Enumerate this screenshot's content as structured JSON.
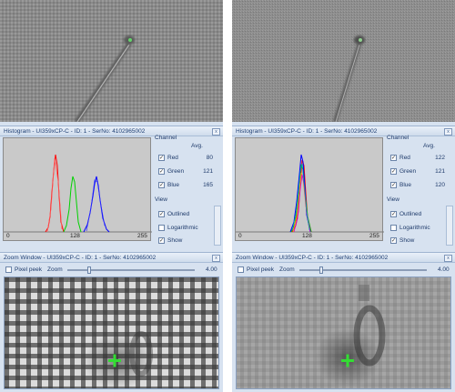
{
  "panels": [
    {
      "histogram": {
        "title": "Histogram - UI359xCP-C - ID: 1 - SerNo: 4102965002",
        "axis": {
          "ticks": [
            "0",
            "128",
            "255"
          ]
        },
        "channel_header": "Channel",
        "avg_header": "Avg.",
        "channels": [
          {
            "label": "Red",
            "avg": "80",
            "color": "#ff0000"
          },
          {
            "label": "Green",
            "avg": "121",
            "color": "#00cc00"
          },
          {
            "label": "Blue",
            "avg": "165",
            "color": "#0000ff"
          }
        ],
        "view_header": "View",
        "view_options": [
          {
            "label": "Outlined",
            "checked": true
          },
          {
            "label": "Logarithmic",
            "checked": false
          },
          {
            "label": "Show",
            "checked": true
          }
        ]
      },
      "zoom": {
        "title": "Zoom Window - UI359xCP-C - ID: 1 - SerNo: 4102965002",
        "pixel_peek_label": "Pixel peek",
        "zoom_label": "Zoom",
        "zoom_value": "4.00"
      }
    },
    {
      "histogram": {
        "title": "Histogram - UI359xCP-C - ID: 1 - SerNo: 4102965002",
        "axis": {
          "ticks": [
            "0",
            "128",
            "255"
          ]
        },
        "channel_header": "Channel",
        "avg_header": "Avg.",
        "channels": [
          {
            "label": "Red",
            "avg": "122",
            "color": "#ff0000"
          },
          {
            "label": "Green",
            "avg": "121",
            "color": "#00cc00"
          },
          {
            "label": "Blue",
            "avg": "120",
            "color": "#0000ff"
          }
        ],
        "view_header": "View",
        "view_options": [
          {
            "label": "Outlined",
            "checked": true
          },
          {
            "label": "Logarithmic",
            "checked": false
          },
          {
            "label": "Show",
            "checked": true
          }
        ]
      },
      "zoom": {
        "title": "Zoom Window - UI359xCP-C - ID: 1 - SerNo: 4102965002",
        "pixel_peek_label": "Pixel peek",
        "zoom_label": "Zoom",
        "zoom_value": "4.00"
      }
    }
  ]
}
